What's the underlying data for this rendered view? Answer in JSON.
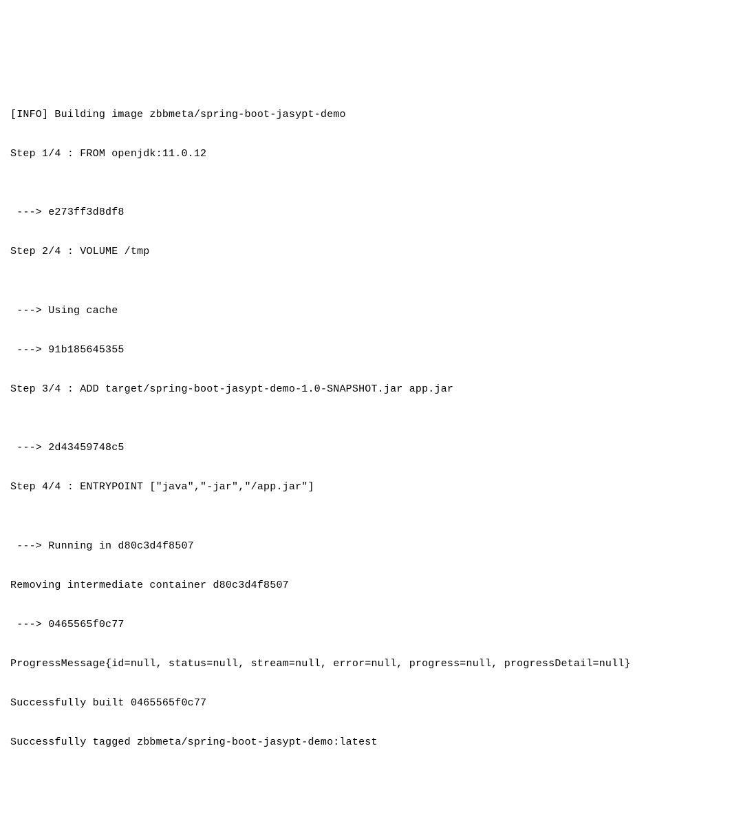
{
  "terminal": {
    "lines": [
      "[INFO] Building image zbbmeta/spring-boot-jasypt-demo",
      "Step 1/4 : FROM openjdk:11.0.12",
      "",
      " ---> e273ff3d8df8",
      "Step 2/4 : VOLUME /tmp",
      "",
      " ---> Using cache",
      " ---> 91b185645355",
      "Step 3/4 : ADD target/spring-boot-jasypt-demo-1.0-SNAPSHOT.jar app.jar",
      "",
      " ---> 2d43459748c5",
      "Step 4/4 : ENTRYPOINT [\"java\",\"-jar\",\"/app.jar\"]",
      "",
      " ---> Running in d80c3d4f8507",
      "Removing intermediate container d80c3d4f8507",
      " ---> 0465565f0c77",
      "ProgressMessage{id=null, status=null, stream=null, error=null, progress=null, progressDetail=null}",
      "Successfully built 0465565f0c77",
      "Successfully tagged zbbmeta/spring-boot-jasypt-demo:latest"
    ]
  }
}
